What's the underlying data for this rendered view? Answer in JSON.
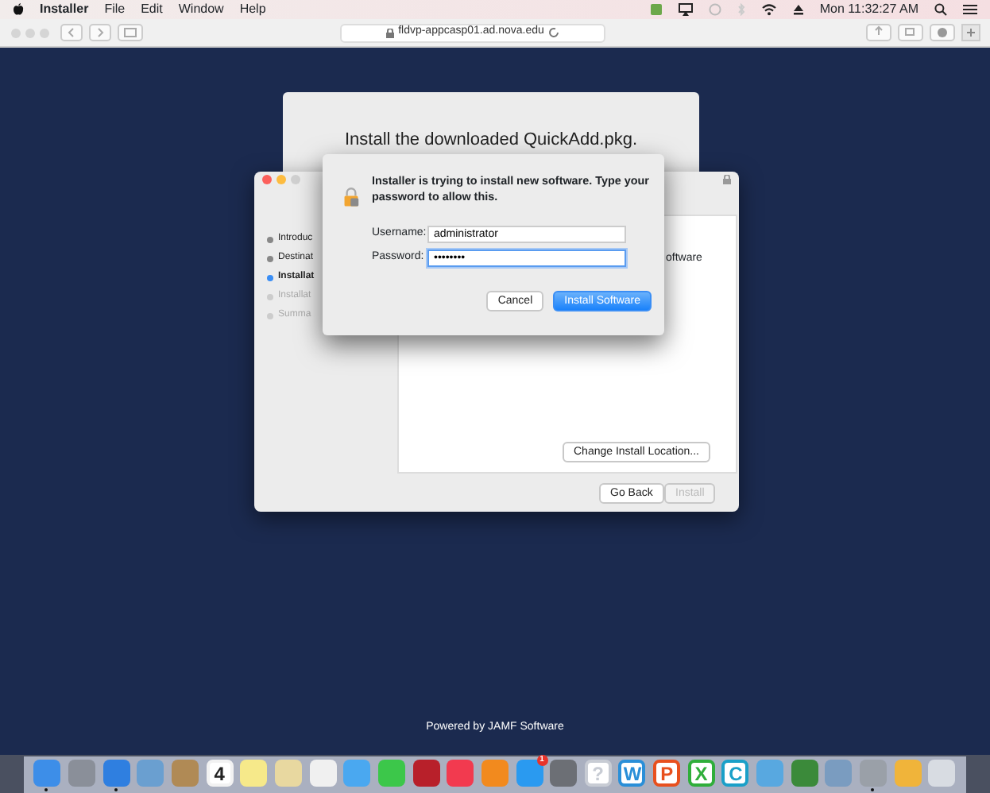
{
  "menu_bar": {
    "app": "Installer",
    "items": [
      "File",
      "Edit",
      "Window",
      "Help"
    ],
    "clock": "Mon 11:32:27 AM"
  },
  "browser": {
    "url": "fldvp-appcasp01.ad.nova.edu"
  },
  "page": {
    "heading": "Install the downloaded QuickAdd.pkg.",
    "footer": "Powered by JAMF Software"
  },
  "installer": {
    "steps": [
      {
        "label": "Introduc",
        "selected": false,
        "disabled": false
      },
      {
        "label": "Destinat",
        "selected": false,
        "disabled": false
      },
      {
        "label": "Installat",
        "selected": true,
        "disabled": false
      },
      {
        "label": "Installat",
        "selected": false,
        "disabled": true
      },
      {
        "label": "Summa",
        "selected": false,
        "disabled": true
      }
    ],
    "content_text": "oftware",
    "change_location": "Change Install Location...",
    "back": "Go Back",
    "install": {
      "label": "Install",
      "disabled": true
    }
  },
  "auth_dialog": {
    "message": "Installer is trying to install new software. Type your password to allow this.",
    "username": {
      "label": "Username:",
      "value": "administrator"
    },
    "password": {
      "label": "Password:",
      "value": "••••••••"
    },
    "cancel": "Cancel",
    "confirm": "Install Software"
  },
  "dock": [
    {
      "color": "#3d8ee8",
      "running": true
    },
    {
      "color": "#8a8f99"
    },
    {
      "color": "#2f7fe0",
      "running": true
    },
    {
      "color": "#6a9fd0"
    },
    {
      "color": "#b08a55"
    },
    {
      "color": "#f2f2f2",
      "glyph": "4"
    },
    {
      "color": "#f6e98a"
    },
    {
      "color": "#e8d8a0"
    },
    {
      "color": "#f0f0f0"
    },
    {
      "color": "#4aa8f0"
    },
    {
      "color": "#3cc74a"
    },
    {
      "color": "#b8202a"
    },
    {
      "color": "#f23a4f"
    },
    {
      "color": "#f28a1e"
    },
    {
      "color": "#2a9af0",
      "badge": "1"
    },
    {
      "color": "#6c6f75"
    },
    {
      "color": "#c8ccd4",
      "glyph": "?"
    },
    {
      "color": "#2a8fd8",
      "glyph": "W"
    },
    {
      "color": "#e8501e",
      "glyph": "P"
    },
    {
      "color": "#2fae3a",
      "glyph": "X"
    },
    {
      "color": "#1aa0c8",
      "glyph": "C"
    },
    {
      "color": "#58a8e0"
    },
    {
      "color": "#3b8a3a"
    },
    {
      "color": "#7a9cc0"
    },
    {
      "color": "#9aa0a8",
      "running": true
    },
    {
      "color": "#f0b43a"
    },
    {
      "color": "#d8dce2"
    }
  ]
}
